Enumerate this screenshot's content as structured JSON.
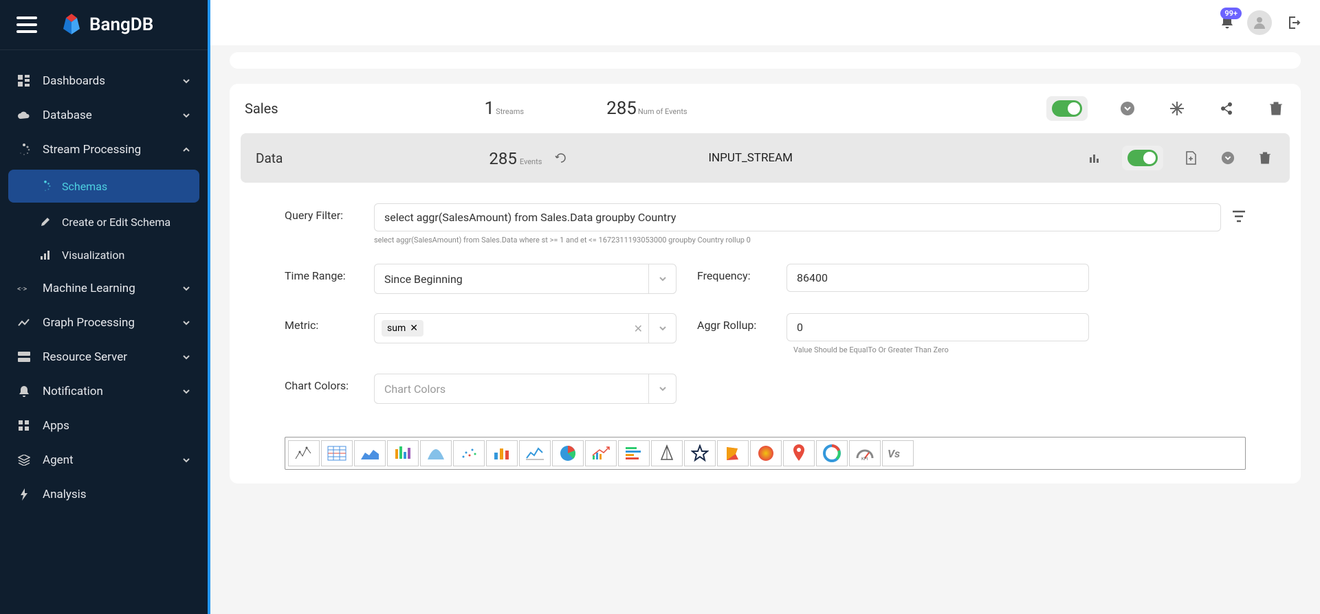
{
  "app_name": "BangDB",
  "notifications_badge": "99+",
  "sidebar": {
    "items": [
      {
        "label": "Dashboards",
        "expandable": true
      },
      {
        "label": "Database",
        "expandable": true
      },
      {
        "label": "Stream Processing",
        "expandable": true,
        "expanded": true
      },
      {
        "label": "Machine Learning",
        "expandable": true
      },
      {
        "label": "Graph Processing",
        "expandable": true
      },
      {
        "label": "Resource Server",
        "expandable": true
      },
      {
        "label": "Notification",
        "expandable": true
      },
      {
        "label": "Apps",
        "expandable": false
      },
      {
        "label": "Agent",
        "expandable": true
      },
      {
        "label": "Analysis",
        "expandable": false
      }
    ],
    "stream_sub": [
      {
        "label": "Schemas",
        "active": true
      },
      {
        "label": "Create or Edit Schema"
      },
      {
        "label": "Visualization"
      }
    ]
  },
  "panel": {
    "title": "Sales",
    "streams_count": "1",
    "streams_label": "Streams",
    "events_count": "285",
    "events_label": "Num of Events"
  },
  "sub": {
    "title": "Data",
    "events_count": "285",
    "events_label": "Events",
    "stream_type": "INPUT_STREAM"
  },
  "form": {
    "query_filter_label": "Query Filter:",
    "query_filter_value": "select aggr(SalesAmount) from Sales.Data groupby Country",
    "query_filter_hint": "select aggr(SalesAmount) from Sales.Data where st >= 1 and et <= 1672311193053000 groupby Country rollup 0",
    "time_range_label": "Time Range:",
    "time_range_value": "Since Beginning",
    "frequency_label": "Frequency:",
    "frequency_value": "86400",
    "metric_label": "Metric:",
    "metric_tag": "sum",
    "aggr_rollup_label": "Aggr Rollup:",
    "aggr_rollup_value": "0",
    "aggr_rollup_hint": "Value Should be EqualTo Or Greater Than Zero",
    "chart_colors_label": "Chart Colors:",
    "chart_colors_placeholder": "Chart Colors"
  },
  "chart_types": [
    "sparkline",
    "table",
    "area",
    "candlestick",
    "bell",
    "scatter",
    "bar",
    "line-trend",
    "pie",
    "trend-up",
    "stacked-bar",
    "compass",
    "star",
    "flag",
    "sphere",
    "map-pin",
    "donut",
    "gauge",
    "vs"
  ]
}
